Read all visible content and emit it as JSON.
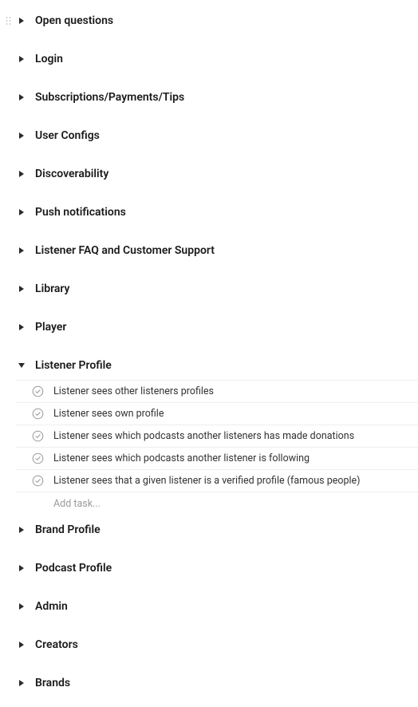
{
  "sections": {
    "open_questions": {
      "label": "Open questions",
      "expanded": false,
      "hover": true
    },
    "login": {
      "label": "Login",
      "expanded": false
    },
    "subscriptions": {
      "label": "Subscriptions/Payments/Tips",
      "expanded": false
    },
    "user_configs": {
      "label": "User Configs",
      "expanded": false
    },
    "discoverability": {
      "label": "Discoverability",
      "expanded": false
    },
    "push_notifications": {
      "label": "Push notifications",
      "expanded": false
    },
    "listener_faq": {
      "label": "Listener FAQ and Customer Support",
      "expanded": false
    },
    "library": {
      "label": "Library",
      "expanded": false
    },
    "player": {
      "label": "Player",
      "expanded": false
    },
    "listener_profile": {
      "label": "Listener Profile",
      "expanded": true,
      "tasks": [
        {
          "text": "Listener sees other listeners profiles"
        },
        {
          "text": "Listener sees own profile"
        },
        {
          "text": "Listener sees which podcasts another listeners has made donations"
        },
        {
          "text": "Listener sees which podcasts another listener is following"
        },
        {
          "text": "Listener sees that a given listener is a verified profile (famous people)"
        }
      ]
    },
    "brand_profile": {
      "label": "Brand Profile",
      "expanded": false
    },
    "podcast_profile": {
      "label": "Podcast Profile",
      "expanded": false
    },
    "admin": {
      "label": "Admin",
      "expanded": false
    },
    "creators": {
      "label": "Creators",
      "expanded": false
    },
    "brands": {
      "label": "Brands",
      "expanded": false
    }
  },
  "add_task_placeholder": "Add task..."
}
